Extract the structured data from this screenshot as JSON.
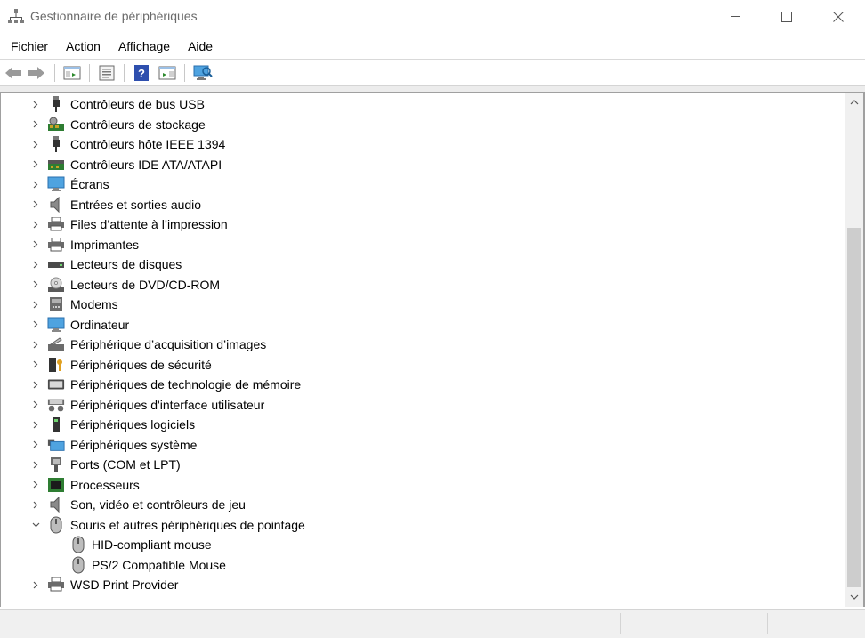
{
  "window": {
    "title": "Gestionnaire de périphériques",
    "controls": {
      "minimize": "—",
      "maximize": "☐",
      "close": "✕"
    }
  },
  "menu": [
    "Fichier",
    "Action",
    "Affichage",
    "Aide"
  ],
  "toolbar": {
    "buttons": [
      "back-arrow-icon",
      "forward-arrow-icon",
      "console-tree-icon",
      "properties-icon",
      "help-icon",
      "action-pane-icon",
      "scan-hardware-icon"
    ]
  },
  "tree": {
    "items": [
      {
        "label": "Contrôleurs de bus USB",
        "icon": "usb-icon",
        "expanded": false
      },
      {
        "label": "Contrôleurs de stockage",
        "icon": "storage-controller-icon",
        "expanded": false
      },
      {
        "label": "Contrôleurs hôte IEEE 1394",
        "icon": "ieee1394-icon",
        "expanded": false
      },
      {
        "label": "Contrôleurs IDE ATA/ATAPI",
        "icon": "ide-controller-icon",
        "expanded": false
      },
      {
        "label": "Écrans",
        "icon": "monitor-icon",
        "expanded": false
      },
      {
        "label": "Entrées et sorties audio",
        "icon": "speaker-icon",
        "expanded": false
      },
      {
        "label": "Files d’attente à l’impression",
        "icon": "print-queue-icon",
        "expanded": false
      },
      {
        "label": "Imprimantes",
        "icon": "printer-icon",
        "expanded": false
      },
      {
        "label": "Lecteurs de disques",
        "icon": "disk-drive-icon",
        "expanded": false
      },
      {
        "label": "Lecteurs de DVD/CD-ROM",
        "icon": "dvd-drive-icon",
        "expanded": false
      },
      {
        "label": "Modems",
        "icon": "modem-icon",
        "expanded": false
      },
      {
        "label": "Ordinateur",
        "icon": "computer-icon",
        "expanded": false
      },
      {
        "label": "Périphérique d’acquisition d’images",
        "icon": "imaging-device-icon",
        "expanded": false
      },
      {
        "label": "Périphériques de sécurité",
        "icon": "security-device-icon",
        "expanded": false
      },
      {
        "label": "Périphériques de technologie de mémoire",
        "icon": "memory-technology-icon",
        "expanded": false
      },
      {
        "label": "Périphériques d'interface utilisateur",
        "icon": "hid-icon",
        "expanded": false
      },
      {
        "label": "Périphériques logiciels",
        "icon": "software-device-icon",
        "expanded": false
      },
      {
        "label": "Périphériques système",
        "icon": "system-device-icon",
        "expanded": false
      },
      {
        "label": "Ports (COM et LPT)",
        "icon": "port-icon",
        "expanded": false
      },
      {
        "label": "Processeurs",
        "icon": "processor-icon",
        "expanded": false
      },
      {
        "label": "Son, vidéo et contrôleurs de jeu",
        "icon": "speaker-icon",
        "expanded": false
      },
      {
        "label": "Souris et autres périphériques de pointage",
        "icon": "mouse-icon",
        "expanded": true
      },
      {
        "label": "HID-compliant mouse",
        "icon": "mouse-icon",
        "child": true
      },
      {
        "label": "PS/2 Compatible Mouse",
        "icon": "mouse-icon",
        "child": true
      },
      {
        "label": "WSD Print Provider",
        "icon": "print-queue-icon",
        "expanded": false
      }
    ]
  },
  "colors": {
    "accent": "#0078d7",
    "text": "#000000",
    "muted": "#6b6b6b"
  }
}
